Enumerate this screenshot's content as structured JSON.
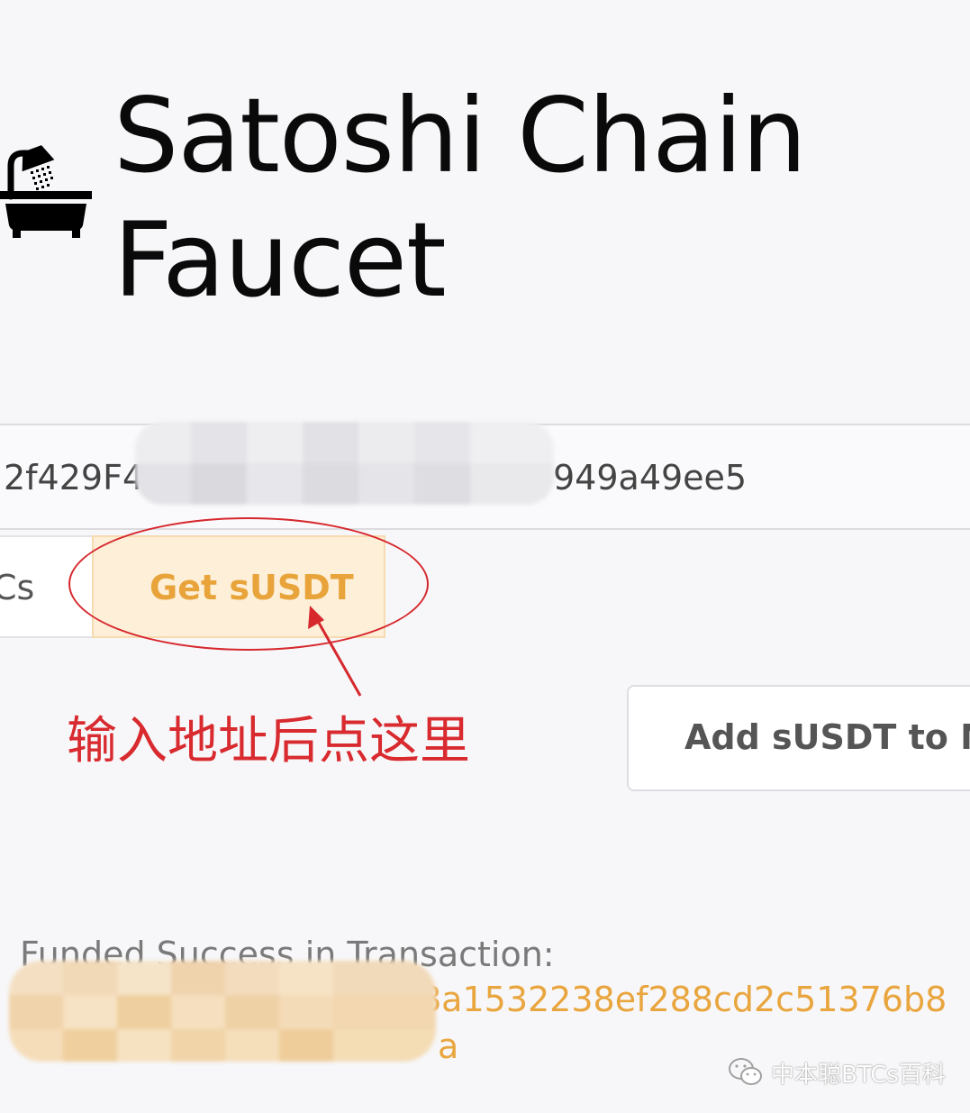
{
  "page": {
    "title_line1": "Satoshi Chain",
    "title_line2": "Faucet",
    "icon": "bathtub-shower-icon"
  },
  "address": {
    "visible_prefix": "2f429F4",
    "visible_suffix": "949a49ee5"
  },
  "tabs": [
    {
      "label": "Cs",
      "active": false
    },
    {
      "label": "Get sUSDT",
      "active": true
    }
  ],
  "annotation": {
    "text": "输入地址后点这里",
    "color": "#d82a2f"
  },
  "actions": {
    "add_label": "Add sUSDT to Me"
  },
  "result": {
    "label": "Funded Success in Transaction:",
    "tx_line1": "8a1532238ef288cd2c51376b8",
    "tx_line2": "a"
  },
  "watermark": {
    "text": "中本聪BTCs百科",
    "icon": "wechat-icon"
  },
  "colors": {
    "accent": "#e8a43a",
    "accent_bg": "#fdefd8",
    "annotation_red": "#d82a2f"
  }
}
